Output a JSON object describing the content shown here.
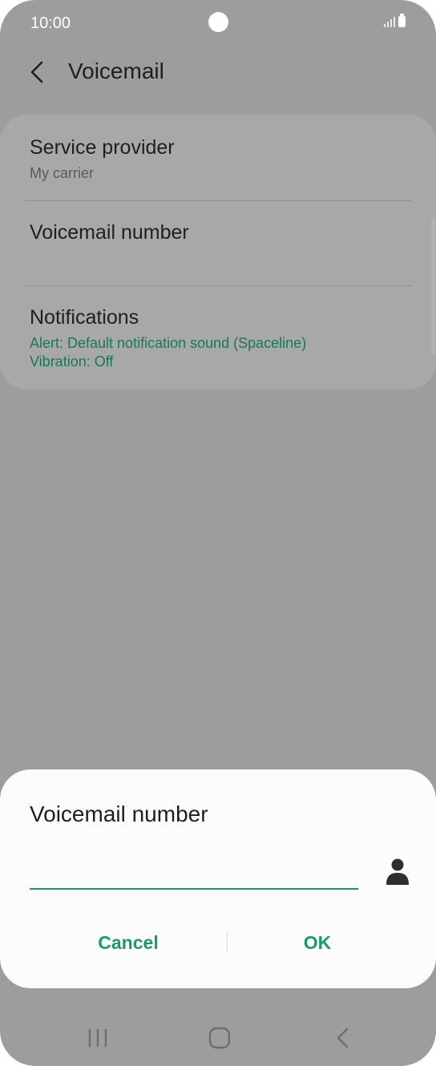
{
  "status_bar": {
    "time": "10:00",
    "icons": [
      "signal-icon",
      "battery-icon"
    ]
  },
  "header": {
    "back_icon": "chevron-left-icon",
    "title": "Voicemail"
  },
  "settings": {
    "items": [
      {
        "title": "Service provider",
        "subtitle": "My carrier"
      },
      {
        "title": "Voicemail number",
        "subtitle": ""
      },
      {
        "title": "Notifications",
        "subtitle": "Alert: Default notification sound (Spaceline)",
        "subtitle2": "Vibration: Off"
      }
    ]
  },
  "dialog": {
    "title": "Voicemail number",
    "input_value": "",
    "input_placeholder": "",
    "contact_icon": "person-icon",
    "cancel_label": "Cancel",
    "ok_label": "OK"
  },
  "nav_bar": {
    "icons": [
      "recent-apps-icon",
      "home-icon",
      "back-icon"
    ]
  },
  "colors": {
    "accent": "#1a9a6c",
    "subtitle_accent": "#157a55",
    "subtitle_gray": "#5a5a5a",
    "scrim": "#9d9d9d"
  }
}
